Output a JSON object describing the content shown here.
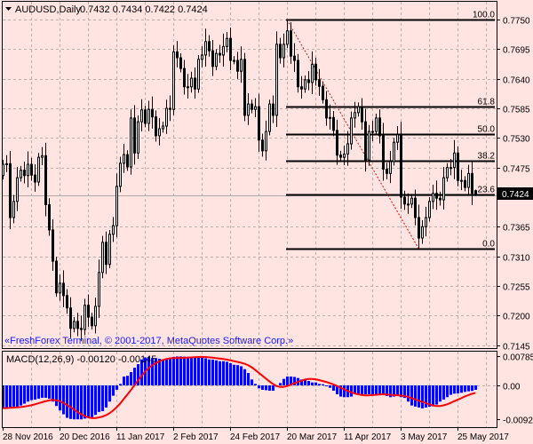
{
  "header": {
    "symbol": "AUDUSD,Daily",
    "ohlc_text": "0.7432 0.7434 0.7422 0.7424",
    "collapse_icon": "triangle-down-icon"
  },
  "copyright": "«FreshForex Terminal, © 2001-2017, MetaQuotes Software Corp.»",
  "current_price_label": "0.7424",
  "colors": {
    "background": "#ffe4e1",
    "candle": "#000000",
    "grid": "#b8b0ae",
    "macd_histogram": "#0000ff",
    "macd_signal": "#ff0000",
    "fib_trend": "#ff0000",
    "copyright": "#1a1aff"
  },
  "chart_data": [
    {
      "type": "candlestick",
      "title": "AUDUSD,Daily",
      "y_ticks": [
        "0.7750",
        "0.7695",
        "0.7640",
        "0.7585",
        "0.7530",
        "0.7475",
        "0.7365",
        "0.7310",
        "0.7255",
        "0.7200",
        "0.7145"
      ],
      "ylim": [
        0.7145,
        0.7785
      ],
      "x_ticks": [
        "28 Nov 2016",
        "20 Dec 2016",
        "11 Jan 2017",
        "2 Feb 2017",
        "24 Feb 2017",
        "20 Mar 2017",
        "11 Apr 2017",
        "3 May 2017",
        "25 May 2017"
      ],
      "bars_per_x_tick": 16,
      "first_open": 0.746,
      "last_bar": {
        "open": 0.7432,
        "high": 0.7434,
        "low": 0.7422,
        "close": 0.7424
      },
      "close": [
        0.7481,
        0.7482,
        0.7382,
        0.7412,
        0.7456,
        0.747,
        0.746,
        0.7481,
        0.7461,
        0.7448,
        0.7494,
        0.7497,
        0.7406,
        0.7359,
        0.7301,
        0.7242,
        0.726,
        0.7237,
        0.7214,
        0.7176,
        0.7189,
        0.7176,
        0.7174,
        0.7219,
        0.7197,
        0.7181,
        0.7217,
        0.728,
        0.7336,
        0.7295,
        0.7351,
        0.7367,
        0.744,
        0.7483,
        0.7499,
        0.7476,
        0.7567,
        0.7502,
        0.756,
        0.7582,
        0.7557,
        0.7583,
        0.7569,
        0.7534,
        0.7547,
        0.7552,
        0.7585,
        0.7583,
        0.769,
        0.7679,
        0.7659,
        0.7625,
        0.7625,
        0.7641,
        0.7621,
        0.7676,
        0.7684,
        0.7709,
        0.7692,
        0.7663,
        0.7687,
        0.7684,
        0.77,
        0.7715,
        0.7674,
        0.7674,
        0.7654,
        0.7676,
        0.7572,
        0.7593,
        0.7583,
        0.7588,
        0.7526,
        0.7506,
        0.7542,
        0.7593,
        0.7572,
        0.7704,
        0.7679,
        0.7704,
        0.7729,
        0.7682,
        0.7674,
        0.7625,
        0.7621,
        0.7638,
        0.7633,
        0.7667,
        0.7638,
        0.7626,
        0.7601,
        0.7567,
        0.7568,
        0.7544,
        0.7498,
        0.7494,
        0.75,
        0.7519,
        0.7567,
        0.7577,
        0.7588,
        0.756,
        0.7489,
        0.7542,
        0.7542,
        0.7567,
        0.7534,
        0.7472,
        0.7464,
        0.7486,
        0.7522,
        0.7536,
        0.742,
        0.7407,
        0.7407,
        0.7418,
        0.7382,
        0.7344,
        0.7365,
        0.7382,
        0.7412,
        0.7427,
        0.7418,
        0.7415,
        0.7456,
        0.7475,
        0.7475,
        0.7502,
        0.7451,
        0.7451,
        0.7438,
        0.7464,
        0.7427,
        0.7424
      ],
      "current_price": 0.7424,
      "fibonacci": {
        "high": 0.775,
        "high_bar": 80,
        "low": 0.7325,
        "low_bar": 117,
        "levels": [
          {
            "label": "100.0",
            "ratio": 1.0
          },
          {
            "label": "61.8",
            "ratio": 0.618
          },
          {
            "label": "50.0",
            "ratio": 0.5
          },
          {
            "label": "38.2",
            "ratio": 0.382
          },
          {
            "label": "23.6",
            "ratio": 0.236
          },
          {
            "label": "0.0",
            "ratio": 0.0
          }
        ]
      }
    },
    {
      "type": "bar+line",
      "title": "MACD(12,26,9) -0.00120 -0.00145",
      "y_ticks": [
        "0.00785",
        "0.00",
        "-0.00921"
      ],
      "ylim": [
        -0.00921,
        0.00785
      ],
      "signal_period": 9,
      "histogram": [
        -0.00616,
        -0.00616,
        -0.006,
        -0.00576,
        -0.00576,
        -0.00544,
        -0.00496,
        -0.0044,
        -0.004,
        -0.00384,
        -0.0036,
        -0.00336,
        -0.00336,
        -0.0036,
        -0.0044,
        -0.0056,
        -0.0068,
        -0.00784,
        -0.0088,
        -0.0091,
        -0.00921,
        -0.00921,
        -0.00921,
        -0.009,
        -0.0088,
        -0.00864,
        -0.008,
        -0.0072,
        -0.007,
        -0.006,
        -0.0044,
        -0.0028,
        -0.0012,
        0.0004,
        0.0024,
        0.0026,
        0.0036,
        0.0048,
        0.00576,
        0.00704,
        0.0076,
        0.00776,
        0.00744,
        0.0074,
        0.0072,
        0.00704,
        0.0072,
        0.00736,
        0.00776,
        0.00785,
        0.00785,
        0.0078,
        0.00775,
        0.0077,
        0.0077,
        0.0077,
        0.0076,
        0.00736,
        0.00704,
        0.007,
        0.0068,
        0.00656,
        0.00656,
        0.0064,
        0.006,
        0.0056,
        0.0055,
        0.0052,
        0.0044,
        0.00336,
        0.0016,
        0.0004,
        -0.0008,
        -0.0012,
        -0.0013,
        -0.00144,
        -0.00144,
        -0.0004,
        0.00064,
        0.00176,
        0.0024,
        0.0024,
        0.0023,
        0.002,
        0.0016,
        0.00144,
        0.0012,
        0.0008,
        0.0008,
        0.0004,
        0.0003,
        -0.00016,
        -0.00064,
        -0.00144,
        -0.0024,
        -0.00304,
        -0.0032,
        -0.0032,
        -0.00304,
        -0.0024,
        -0.00224,
        -0.0024,
        -0.0024,
        -0.0024,
        -0.0024,
        -0.0024,
        -0.0024,
        -0.00256,
        -0.00288,
        -0.0032,
        -0.00304,
        -0.0028,
        -0.0032,
        -0.0034,
        -0.0044,
        -0.00544,
        -0.00576,
        -0.006,
        -0.00624,
        -0.006,
        -0.00576,
        -0.0057,
        -0.0052,
        -0.0044,
        -0.00384,
        -0.0032,
        -0.00256,
        -0.00224,
        -0.0022,
        -0.002,
        -0.00176,
        -0.0016,
        -0.0015,
        -0.0012
      ]
    }
  ]
}
